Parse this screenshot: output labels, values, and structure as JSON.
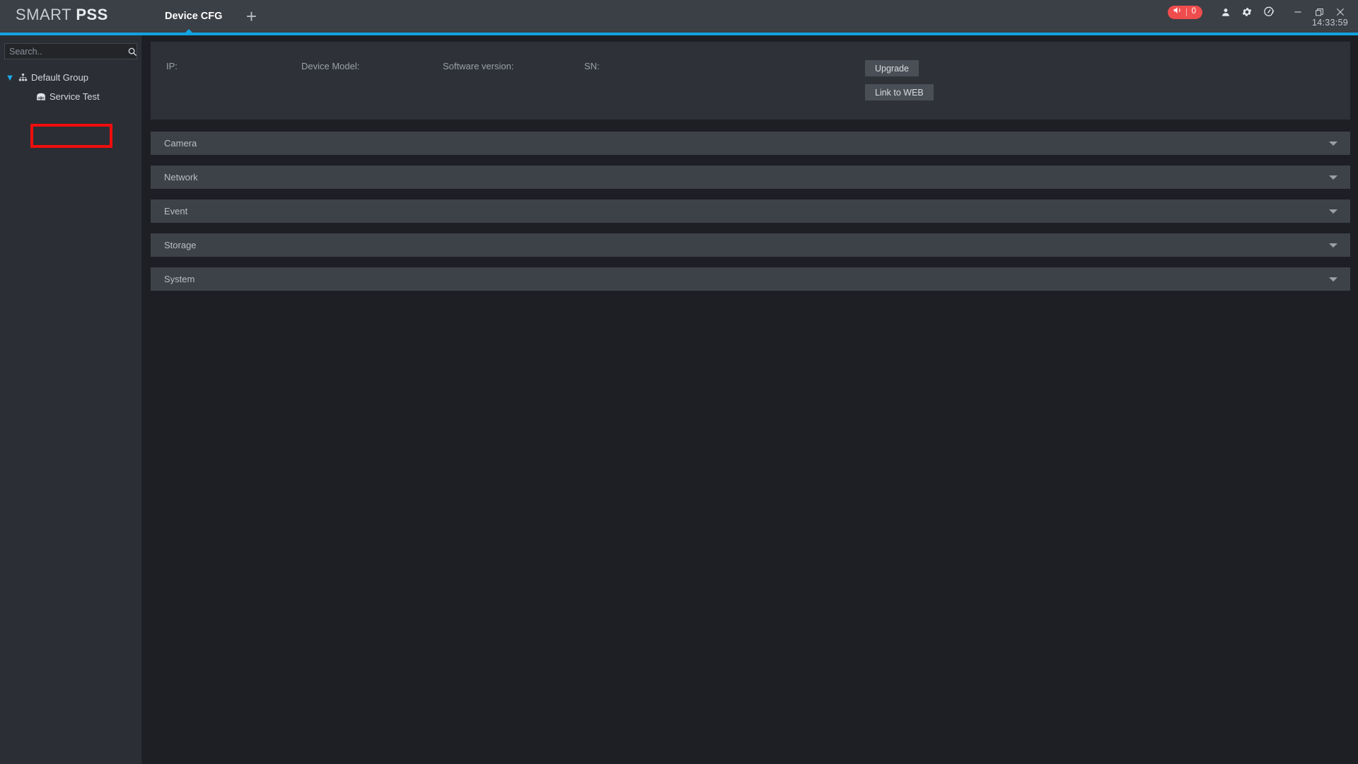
{
  "app": {
    "brand_light": "SMART ",
    "brand_bold": "PSS",
    "clock": "14:33:59"
  },
  "titlebar": {
    "tabs": [
      {
        "label": "Device CFG",
        "active": true
      }
    ],
    "add_tab_label": "+",
    "alarm": {
      "icon": "speaker-alarm-icon",
      "count": "0",
      "color": "#ef4d4d"
    },
    "icons": [
      {
        "name": "user-icon"
      },
      {
        "name": "gear-icon"
      },
      {
        "name": "speedometer-icon"
      }
    ],
    "window_controls": [
      {
        "name": "minimize-icon"
      },
      {
        "name": "maximize-icon"
      },
      {
        "name": "close-icon"
      }
    ],
    "accent_color": "#12a3e0"
  },
  "sidebar": {
    "search": {
      "placeholder": "Search..",
      "value": "",
      "icon": "search-icon"
    },
    "tree": [
      {
        "label": "Default Group",
        "icon": "group-tree-icon",
        "expanded": true,
        "caret": "▼"
      },
      {
        "label": "Service Test",
        "icon": "device-nvr-icon",
        "highlighted": true
      }
    ],
    "highlight_color": "#f20d0d"
  },
  "main": {
    "info": {
      "fields": [
        {
          "label": "IP:",
          "value": ""
        },
        {
          "label": "Device Model:",
          "value": ""
        },
        {
          "label": "Software version:",
          "value": ""
        },
        {
          "label": "SN:",
          "value": ""
        }
      ],
      "buttons": [
        {
          "label": "Upgrade"
        },
        {
          "label": "Link to WEB"
        }
      ]
    },
    "sections": [
      {
        "label": "Camera",
        "expanded": false,
        "chevron": "▼"
      },
      {
        "label": "Network",
        "expanded": false,
        "chevron": "▼"
      },
      {
        "label": "Event",
        "expanded": false,
        "chevron": "▼"
      },
      {
        "label": "Storage",
        "expanded": false,
        "chevron": "▼"
      },
      {
        "label": "System",
        "expanded": false,
        "chevron": "▼"
      }
    ]
  }
}
